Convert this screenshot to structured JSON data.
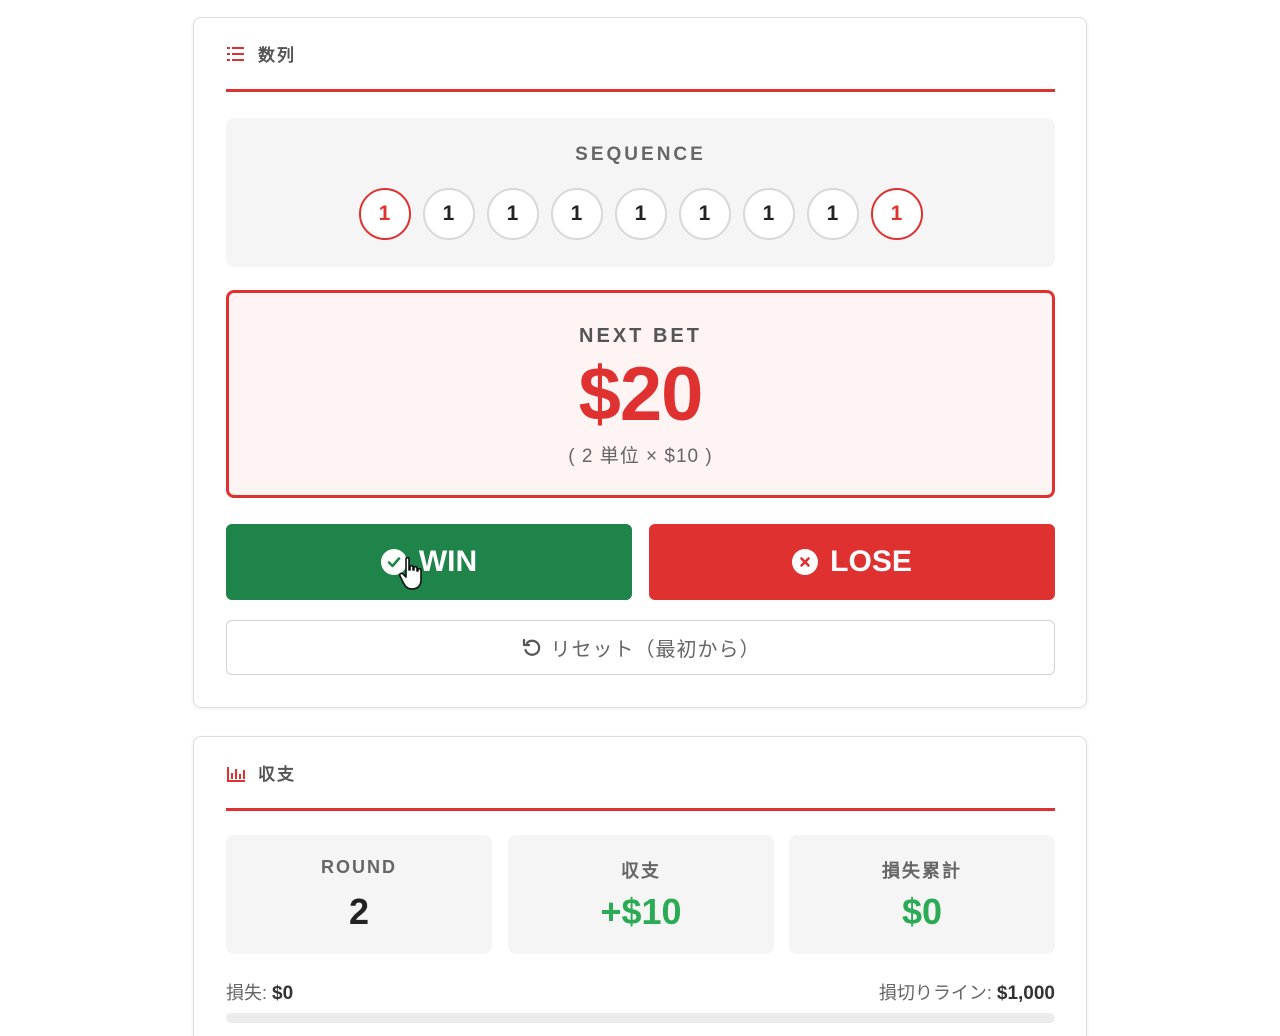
{
  "sequence_section": {
    "title": "数列",
    "icon": "list-icon",
    "label": "SEQUENCE",
    "items": [
      "1",
      "1",
      "1",
      "1",
      "1",
      "1",
      "1",
      "1",
      "1"
    ]
  },
  "next_bet": {
    "label": "NEXT BET",
    "amount": "$20",
    "detail": "( 2 単位 × $10 )"
  },
  "actions": {
    "win_label": "WIN",
    "win_icon": "check-circle-icon",
    "lose_label": "LOSE",
    "lose_icon": "x-circle-icon",
    "reset_label": "リセット（最初から）",
    "reset_icon": "undo-icon"
  },
  "balance_section": {
    "title": "収支",
    "icon": "bar-chart-icon",
    "stats": [
      {
        "label": "ROUND",
        "value": "2"
      },
      {
        "label": "収支",
        "value": "+$10"
      },
      {
        "label": "損失累計",
        "value": "$0"
      }
    ],
    "loss_label": "損失:",
    "loss_value": "$0",
    "stop_label": "損切りライン:",
    "stop_value": "$1,000",
    "loss_progress_fraction": 0
  },
  "colors": {
    "accent": "#e03131",
    "win": "#1f8449",
    "positive": "#2bab55"
  }
}
